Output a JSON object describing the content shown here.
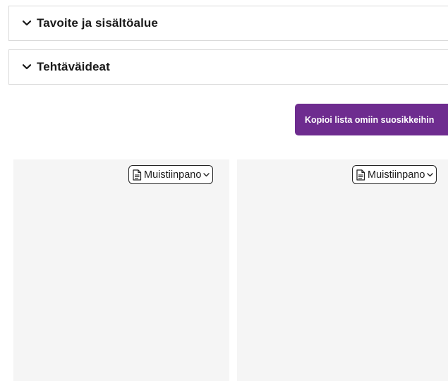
{
  "accordions": [
    {
      "title": "Tavoite ja sisältöalue",
      "icon": "chevron-down-icon"
    },
    {
      "title": "Tehtäväideat",
      "icon": "chevron-down-icon"
    }
  ],
  "actions": {
    "copy_list_label": "Kopioi lista omiin suosikkeihin",
    "copy_button_color": "#6e2c8f"
  },
  "cards": [
    {
      "type_label": "Muistiinpano",
      "icon": "document-icon"
    },
    {
      "type_label": "Muistiinpano",
      "icon": "document-icon"
    }
  ]
}
